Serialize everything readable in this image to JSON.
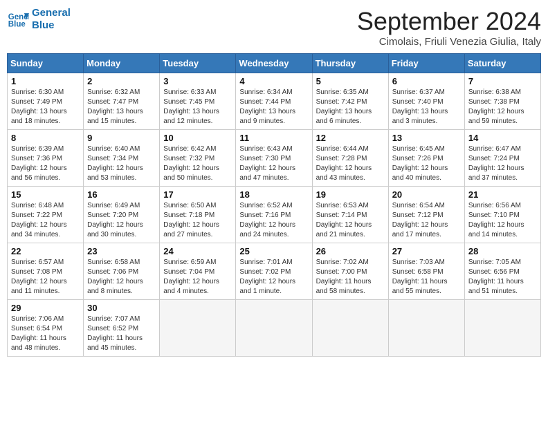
{
  "header": {
    "logo_line1": "General",
    "logo_line2": "Blue",
    "month": "September 2024",
    "location": "Cimolais, Friuli Venezia Giulia, Italy"
  },
  "days_of_week": [
    "Sunday",
    "Monday",
    "Tuesday",
    "Wednesday",
    "Thursday",
    "Friday",
    "Saturday"
  ],
  "weeks": [
    [
      {
        "day": "1",
        "sunrise": "6:30 AM",
        "sunset": "7:49 PM",
        "daylight": "13 hours and 18 minutes."
      },
      {
        "day": "2",
        "sunrise": "6:32 AM",
        "sunset": "7:47 PM",
        "daylight": "13 hours and 15 minutes."
      },
      {
        "day": "3",
        "sunrise": "6:33 AM",
        "sunset": "7:45 PM",
        "daylight": "13 hours and 12 minutes."
      },
      {
        "day": "4",
        "sunrise": "6:34 AM",
        "sunset": "7:44 PM",
        "daylight": "13 hours and 9 minutes."
      },
      {
        "day": "5",
        "sunrise": "6:35 AM",
        "sunset": "7:42 PM",
        "daylight": "13 hours and 6 minutes."
      },
      {
        "day": "6",
        "sunrise": "6:37 AM",
        "sunset": "7:40 PM",
        "daylight": "13 hours and 3 minutes."
      },
      {
        "day": "7",
        "sunrise": "6:38 AM",
        "sunset": "7:38 PM",
        "daylight": "12 hours and 59 minutes."
      }
    ],
    [
      {
        "day": "8",
        "sunrise": "6:39 AM",
        "sunset": "7:36 PM",
        "daylight": "12 hours and 56 minutes."
      },
      {
        "day": "9",
        "sunrise": "6:40 AM",
        "sunset": "7:34 PM",
        "daylight": "12 hours and 53 minutes."
      },
      {
        "day": "10",
        "sunrise": "6:42 AM",
        "sunset": "7:32 PM",
        "daylight": "12 hours and 50 minutes."
      },
      {
        "day": "11",
        "sunrise": "6:43 AM",
        "sunset": "7:30 PM",
        "daylight": "12 hours and 47 minutes."
      },
      {
        "day": "12",
        "sunrise": "6:44 AM",
        "sunset": "7:28 PM",
        "daylight": "12 hours and 43 minutes."
      },
      {
        "day": "13",
        "sunrise": "6:45 AM",
        "sunset": "7:26 PM",
        "daylight": "12 hours and 40 minutes."
      },
      {
        "day": "14",
        "sunrise": "6:47 AM",
        "sunset": "7:24 PM",
        "daylight": "12 hours and 37 minutes."
      }
    ],
    [
      {
        "day": "15",
        "sunrise": "6:48 AM",
        "sunset": "7:22 PM",
        "daylight": "12 hours and 34 minutes."
      },
      {
        "day": "16",
        "sunrise": "6:49 AM",
        "sunset": "7:20 PM",
        "daylight": "12 hours and 30 minutes."
      },
      {
        "day": "17",
        "sunrise": "6:50 AM",
        "sunset": "7:18 PM",
        "daylight": "12 hours and 27 minutes."
      },
      {
        "day": "18",
        "sunrise": "6:52 AM",
        "sunset": "7:16 PM",
        "daylight": "12 hours and 24 minutes."
      },
      {
        "day": "19",
        "sunrise": "6:53 AM",
        "sunset": "7:14 PM",
        "daylight": "12 hours and 21 minutes."
      },
      {
        "day": "20",
        "sunrise": "6:54 AM",
        "sunset": "7:12 PM",
        "daylight": "12 hours and 17 minutes."
      },
      {
        "day": "21",
        "sunrise": "6:56 AM",
        "sunset": "7:10 PM",
        "daylight": "12 hours and 14 minutes."
      }
    ],
    [
      {
        "day": "22",
        "sunrise": "6:57 AM",
        "sunset": "7:08 PM",
        "daylight": "12 hours and 11 minutes."
      },
      {
        "day": "23",
        "sunrise": "6:58 AM",
        "sunset": "7:06 PM",
        "daylight": "12 hours and 8 minutes."
      },
      {
        "day": "24",
        "sunrise": "6:59 AM",
        "sunset": "7:04 PM",
        "daylight": "12 hours and 4 minutes."
      },
      {
        "day": "25",
        "sunrise": "7:01 AM",
        "sunset": "7:02 PM",
        "daylight": "12 hours and 1 minute."
      },
      {
        "day": "26",
        "sunrise": "7:02 AM",
        "sunset": "7:00 PM",
        "daylight": "11 hours and 58 minutes."
      },
      {
        "day": "27",
        "sunrise": "7:03 AM",
        "sunset": "6:58 PM",
        "daylight": "11 hours and 55 minutes."
      },
      {
        "day": "28",
        "sunrise": "7:05 AM",
        "sunset": "6:56 PM",
        "daylight": "11 hours and 51 minutes."
      }
    ],
    [
      {
        "day": "29",
        "sunrise": "7:06 AM",
        "sunset": "6:54 PM",
        "daylight": "11 hours and 48 minutes."
      },
      {
        "day": "30",
        "sunrise": "7:07 AM",
        "sunset": "6:52 PM",
        "daylight": "11 hours and 45 minutes."
      },
      null,
      null,
      null,
      null,
      null
    ]
  ]
}
